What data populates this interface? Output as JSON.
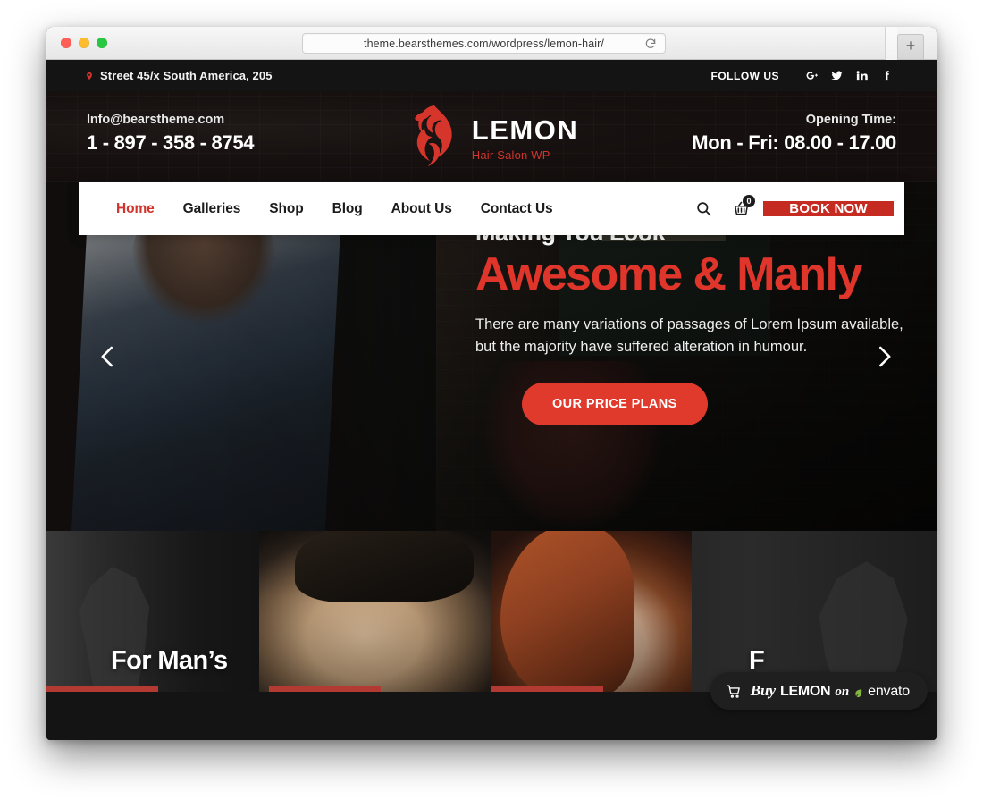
{
  "browser": {
    "url": "theme.bearsthemes.com/wordpress/lemon-hair/",
    "reload_icon": "reload-icon",
    "new_tab_label": "+",
    "traffic_lights": [
      "close",
      "minimize",
      "zoom"
    ]
  },
  "topbar": {
    "address": "Street 45/x South America, 205",
    "pin_icon": "location-pin-icon",
    "follow_label": "FOLLOW US",
    "socials": [
      {
        "name": "google-plus-icon",
        "label": "G+"
      },
      {
        "name": "twitter-icon",
        "label": "Twitter"
      },
      {
        "name": "linkedin-icon",
        "label": "LinkedIn"
      },
      {
        "name": "facebook-icon",
        "label": "Facebook"
      }
    ]
  },
  "header": {
    "email": "Info@bearstheme.com",
    "phone": "1 - 897 - 358 - 8754",
    "opening_label": "Opening Time:",
    "opening_hours": "Mon - Fri: 08.00 - 17.00",
    "logo_name": "LEMON",
    "logo_tagline": "Hair Salon WP",
    "logo_icon": "lemon-hair-woman-logo-icon"
  },
  "nav": {
    "items": [
      {
        "label": "Home",
        "active": true
      },
      {
        "label": "Galleries",
        "active": false
      },
      {
        "label": "Shop",
        "active": false
      },
      {
        "label": "Blog",
        "active": false
      },
      {
        "label": "About Us",
        "active": false
      },
      {
        "label": "Contact Us",
        "active": false
      }
    ],
    "search_icon": "search-icon",
    "cart_icon": "shopping-basket-icon",
    "cart_count": "0",
    "book_label": "BOOK NOW"
  },
  "hero": {
    "subtitle": "Making You Look",
    "title": "Awesome & Manly",
    "description": "There are many variations of passages of Lorem Ipsum available, but the majority have suffered alteration in humour.",
    "cta_label": "OUR PRICE PLANS",
    "prev_icon": "chevron-left-icon",
    "next_icon": "chevron-right-icon"
  },
  "split": {
    "left_label": "For Man’s",
    "right_label": "F"
  },
  "envato": {
    "cart_icon": "cart-icon",
    "buy": "Buy",
    "product": "LEMON",
    "on": "on",
    "leaf_icon": "envato-leaf-icon",
    "marketplace": "envato"
  },
  "colors": {
    "accent_red": "#d0342c",
    "button_red": "#c62b22",
    "cta_red": "#df3a2c",
    "dark": "#141414",
    "white": "#ffffff"
  }
}
